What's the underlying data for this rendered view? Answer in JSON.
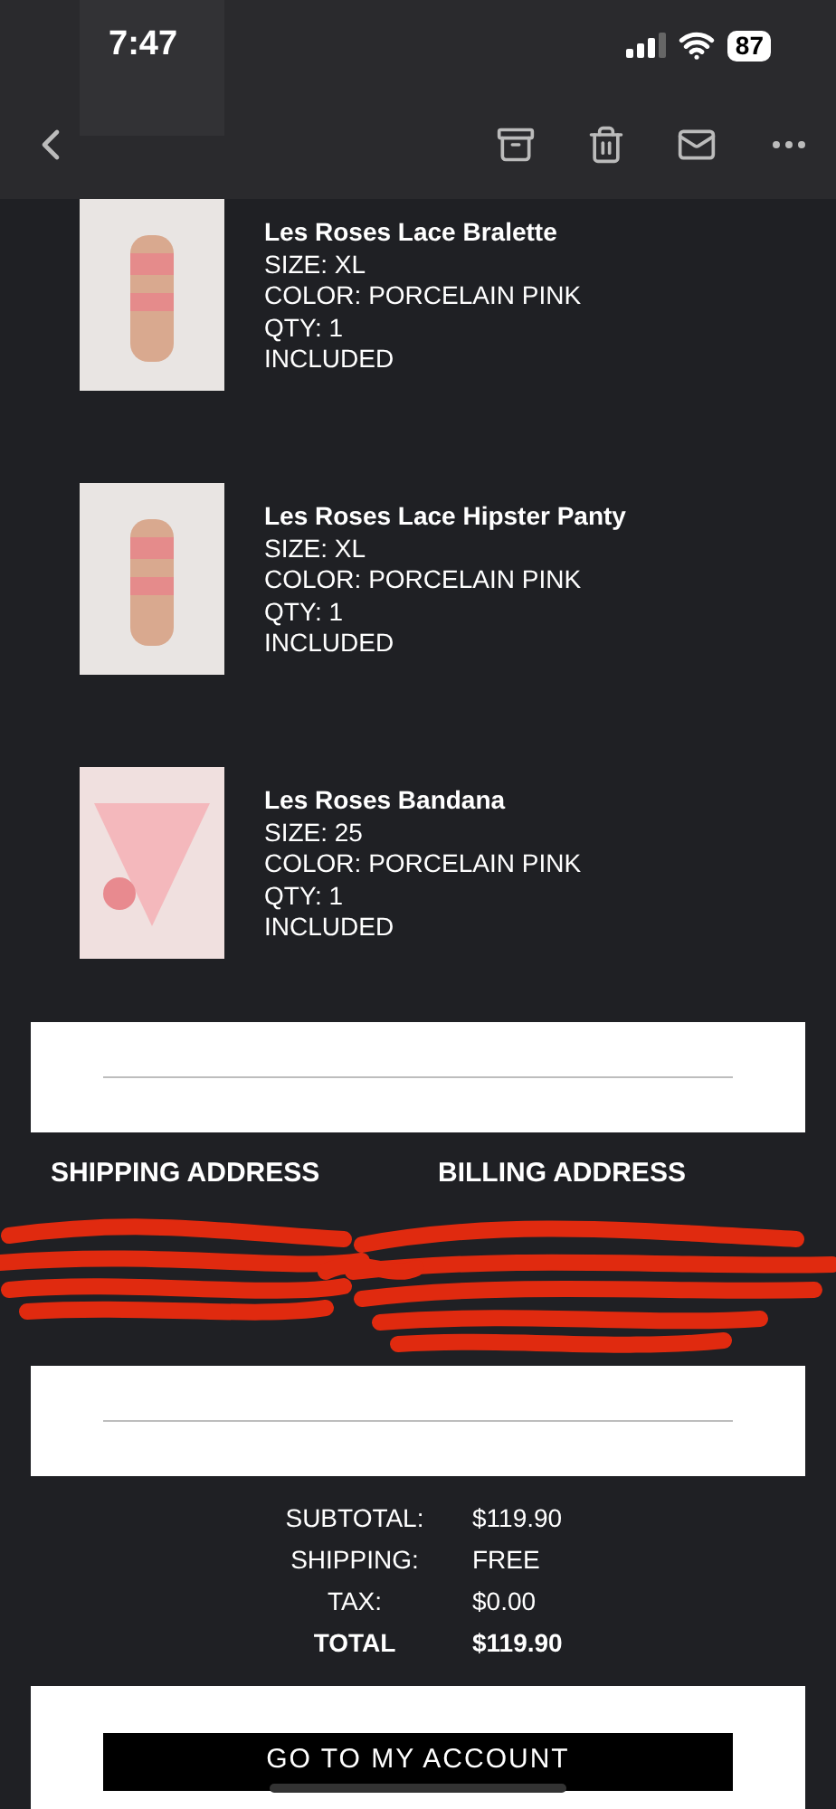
{
  "status_bar": {
    "time": "7:47",
    "battery": "87"
  },
  "products": [
    {
      "name": "Les Roses Lace Bralette",
      "lines": [
        "SIZE: XL",
        "COLOR: PORCELAIN PINK",
        "QTY: 1",
        "INCLUDED"
      ],
      "kind": "model"
    },
    {
      "name": "Les Roses Lace Hipster Panty",
      "lines": [
        "SIZE: XL",
        "COLOR: PORCELAIN PINK",
        "QTY: 1",
        "INCLUDED"
      ],
      "kind": "model"
    },
    {
      "name": "Les Roses Bandana",
      "lines": [
        "SIZE: 25",
        "COLOR: PORCELAIN PINK",
        "QTY: 1",
        "INCLUDED"
      ],
      "kind": "bandana"
    }
  ],
  "addresses": {
    "shipping_heading": "SHIPPING ADDRESS",
    "billing_heading": "BILLING ADDRESS"
  },
  "totals": [
    {
      "label": "SUBTOTAL:",
      "value": "$119.90",
      "bold": false
    },
    {
      "label": "SHIPPING:",
      "value": "FREE",
      "bold": false
    },
    {
      "label": "TAX:",
      "value": "$0.00",
      "bold": false
    },
    {
      "label": "TOTAL",
      "value": "$119.90",
      "bold": true
    }
  ],
  "account_button": "GO TO MY ACCOUNT"
}
